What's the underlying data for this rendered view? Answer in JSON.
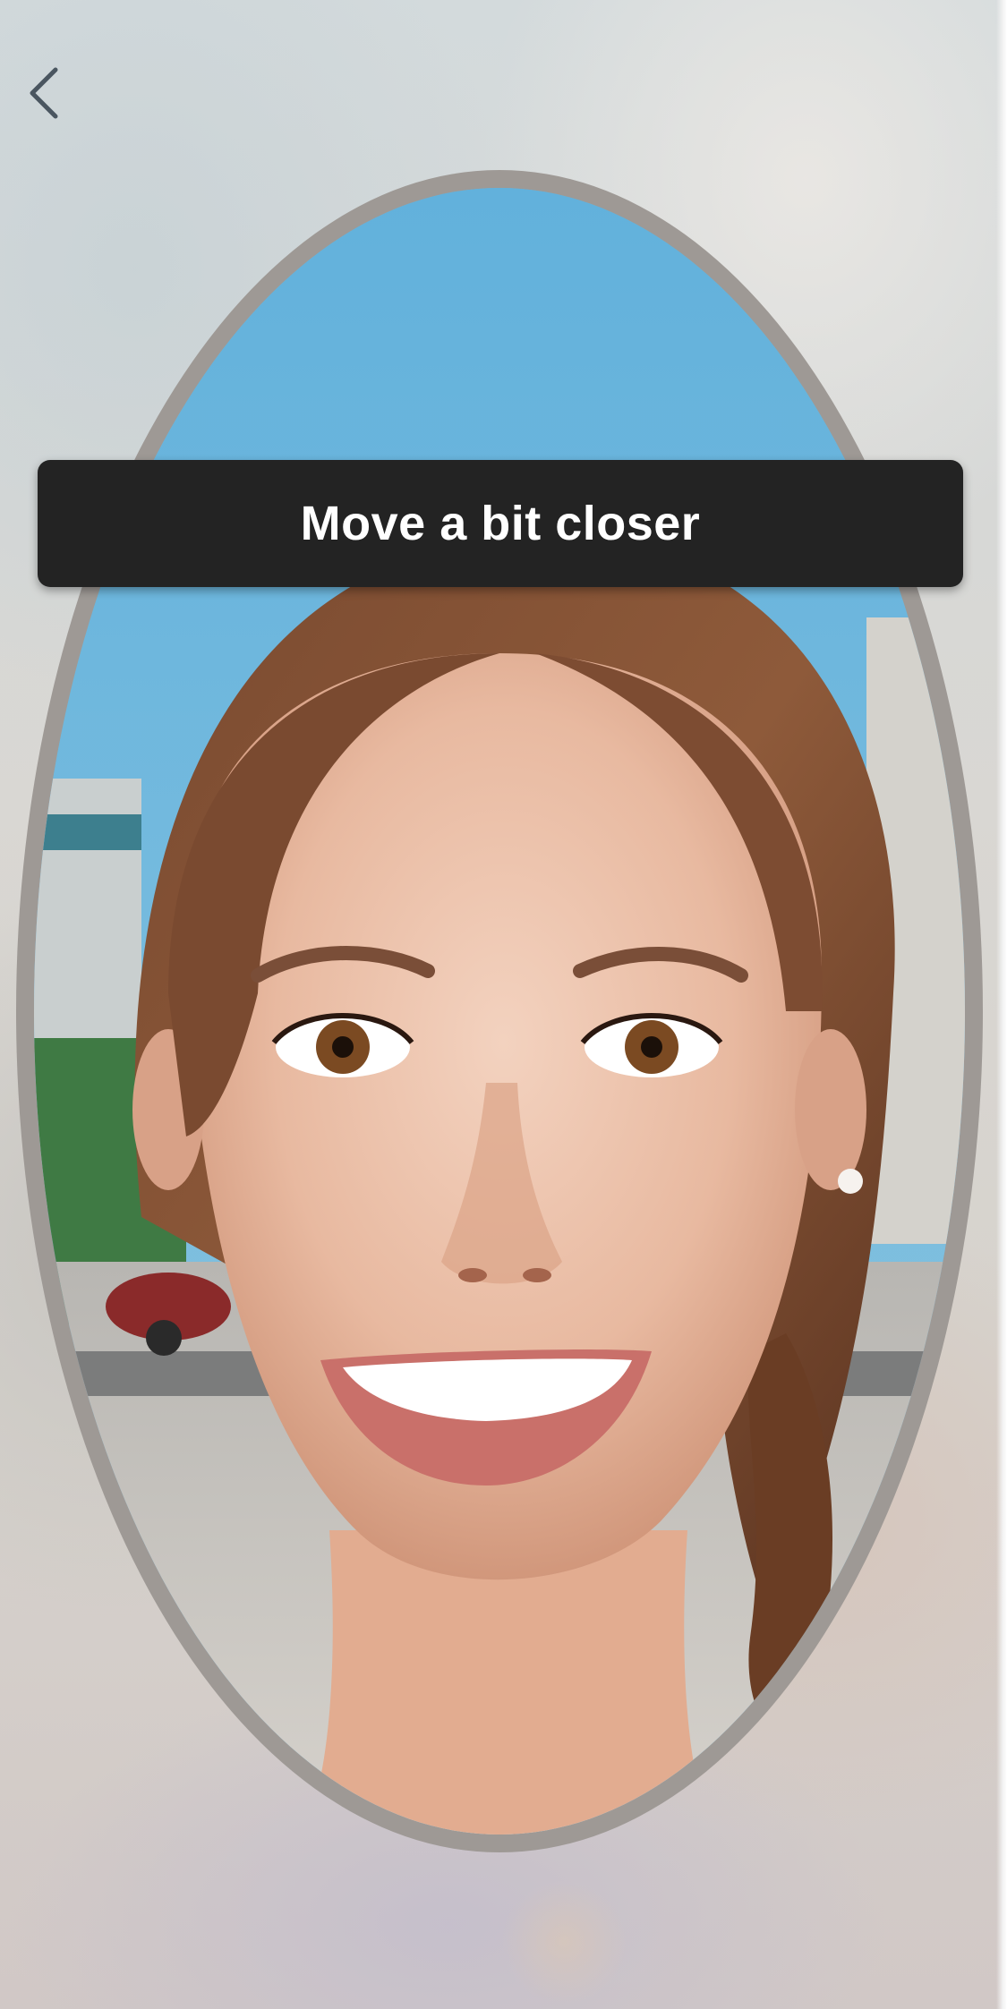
{
  "navigation": {
    "back_icon": "chevron-left-icon"
  },
  "camera": {
    "frame_shape": "oval",
    "frame_color": "#9e9995"
  },
  "instruction": {
    "text": "Move a bit closer"
  },
  "colors": {
    "banner_background": "#232323",
    "banner_text": "#ffffff",
    "back_icon": "#4a5660"
  }
}
